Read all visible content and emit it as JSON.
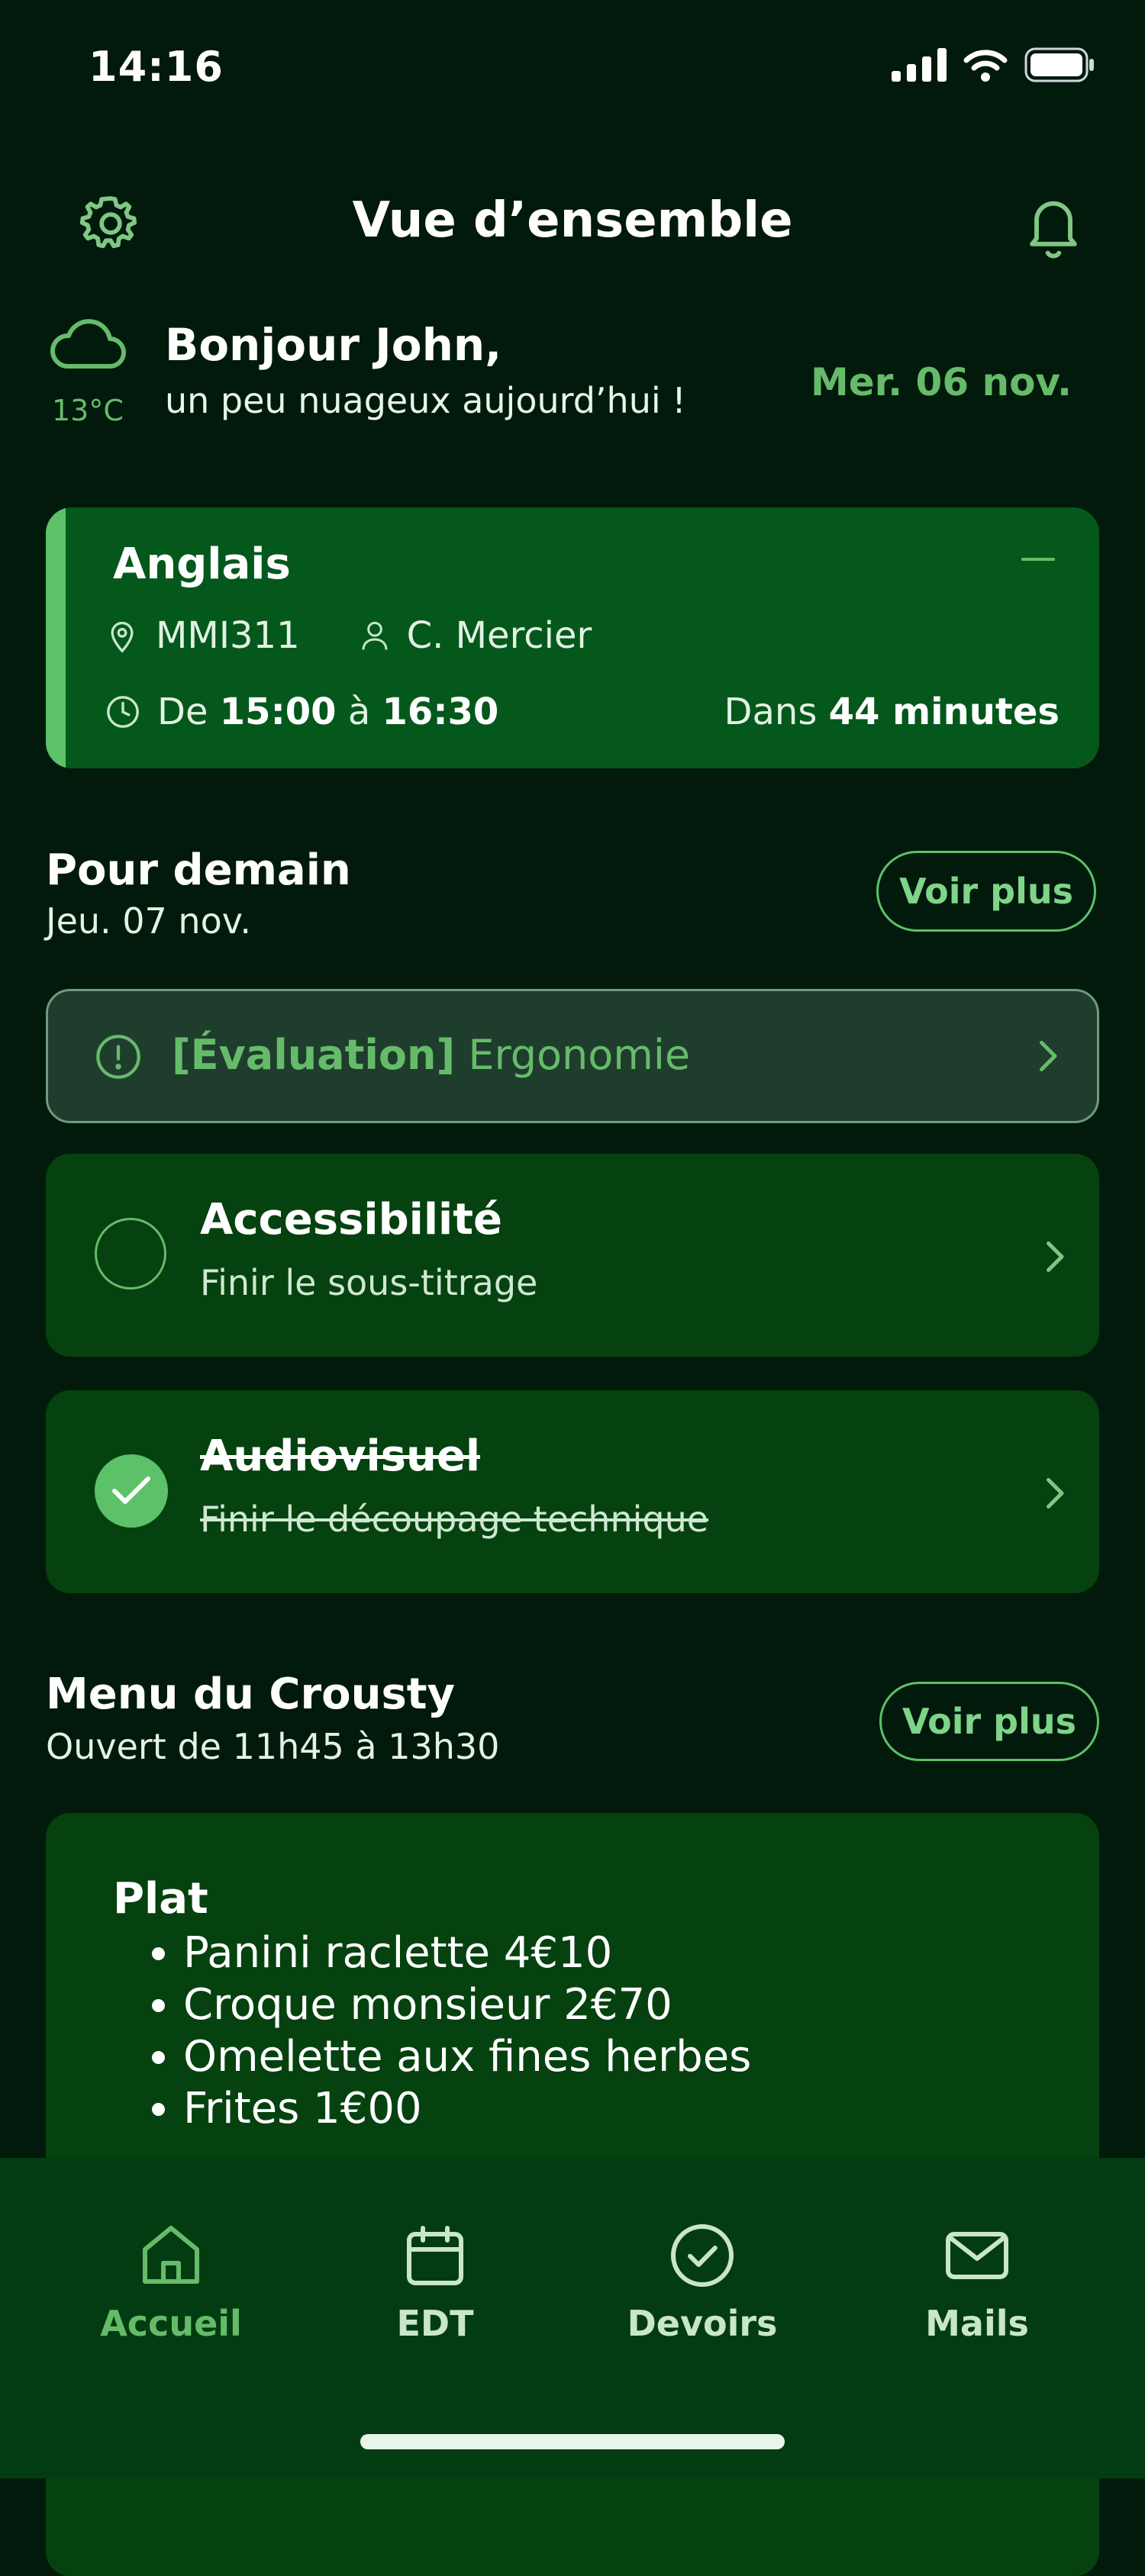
{
  "status_bar": {
    "time": "14:16"
  },
  "header": {
    "title": "Vue d’ensemble",
    "settings_icon": "gear-icon",
    "notifications_icon": "bell-icon"
  },
  "greeting": {
    "weather_icon": "cloud-icon",
    "temperature": "13°C",
    "name_line": "Bonjour John,",
    "weather_line": "un peu nuageux aujourd’hui !",
    "date": "Mer. 06 nov."
  },
  "next_course": {
    "subject": "Anglais",
    "room": "MMI311",
    "teacher": "C. Mercier",
    "time_prefix": "De",
    "start": "15:00",
    "time_separator": "à",
    "end": "16:30",
    "countdown_prefix": "Dans",
    "countdown": "44 minutes",
    "accent_color": "#5cc169"
  },
  "homework": {
    "title": "Pour demain",
    "date": "Jeu. 07 nov.",
    "more_label": "Voir plus",
    "evaluation": {
      "tag": "[Évaluation]",
      "subject": "Ergonomie"
    },
    "tasks": [
      {
        "subject": "Accessibilité",
        "description": "Finir le sous-titrage",
        "done": false
      },
      {
        "subject": "Audiovisuel",
        "description": "Finir le découpage technique",
        "done": true
      }
    ]
  },
  "canteen": {
    "title": "Menu du Crousty",
    "hours": "Ouvert de 11h45 à 13h30",
    "more_label": "Voir plus",
    "section": "Plat",
    "items": [
      "Panini raclette 4€10",
      "Croque monsieur 2€70",
      "Omelette aux fines herbes",
      "Frites 1€00"
    ]
  },
  "tabbar": {
    "tabs": [
      {
        "label": "Accueil",
        "icon": "home-icon",
        "active": true
      },
      {
        "label": "EDT",
        "icon": "calendar-icon",
        "active": false
      },
      {
        "label": "Devoirs",
        "icon": "check-circle-icon",
        "active": false
      },
      {
        "label": "Mails",
        "icon": "mail-icon",
        "active": false
      }
    ]
  }
}
